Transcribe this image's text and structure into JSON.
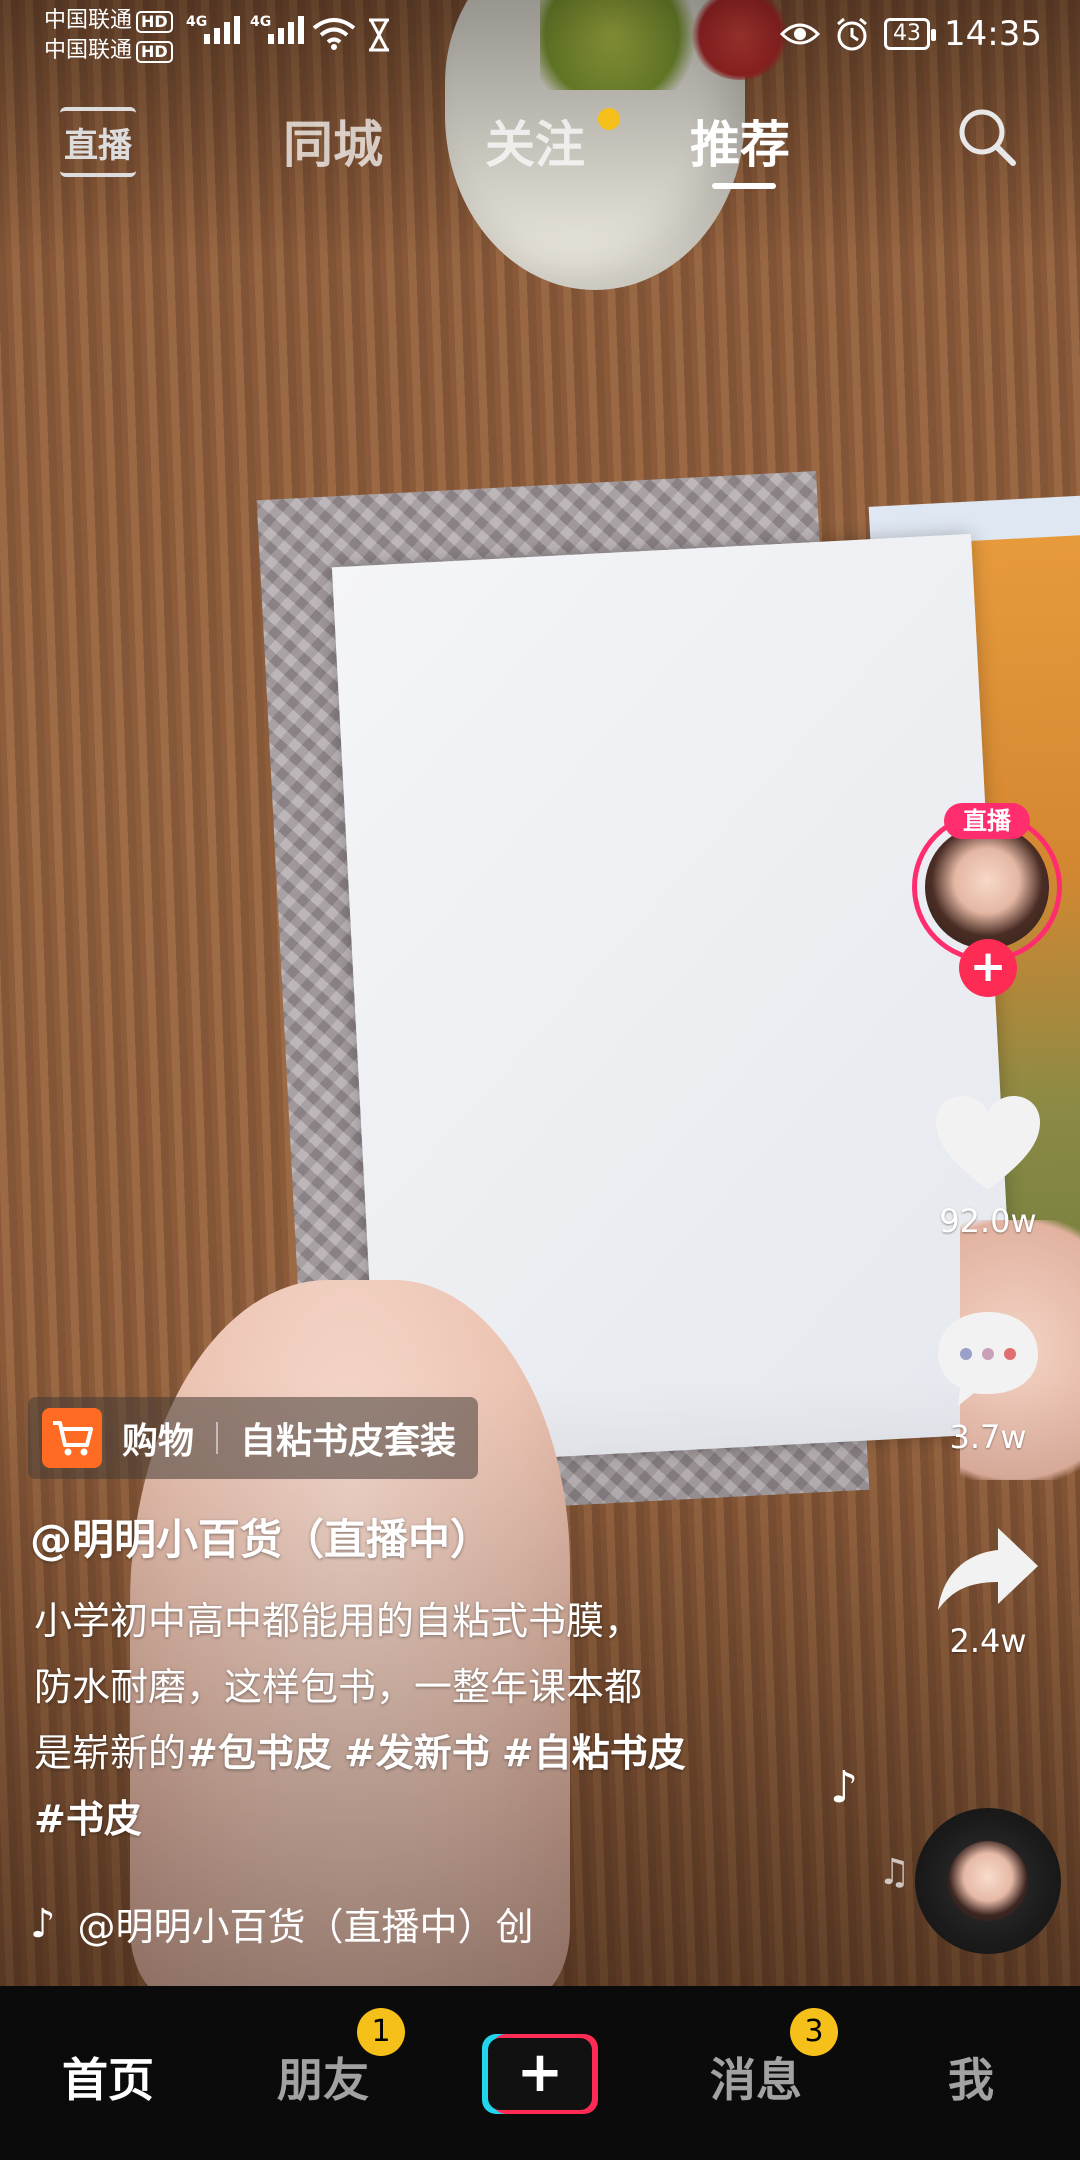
{
  "status_bar": {
    "carrier_1": "中国联通",
    "carrier_2": "中国联通",
    "hd_badge": "HD",
    "network_type": "4G",
    "battery": "43",
    "time": "14:35"
  },
  "top_nav": {
    "live_label": "直播",
    "tabs": [
      "同城",
      "关注",
      "推荐"
    ],
    "active_tab": "推荐",
    "notification_dot_color": "#f6c01a"
  },
  "right_rail": {
    "live_tag": "直播",
    "follow_symbol": "+",
    "likes": "92.0w",
    "comments": "3.7w",
    "shares": "2.4w"
  },
  "shop": {
    "label": "购物",
    "title": "自粘书皮套装",
    "icon": "cart-icon",
    "icon_color": "#ff6b22"
  },
  "post": {
    "author": "@明明小百货（直播中）",
    "description_text_1": "小学初中高中都能用的自粘式书膜，",
    "description_text_2": "防水耐磨，这样包书，一整年课本都",
    "description_text_3": "是崭新的",
    "hashtags": [
      "#包书皮",
      "#发新书",
      "#自粘书皮",
      "#书皮"
    ],
    "music": "@明明小百货（直播中）创"
  },
  "bottom_nav": {
    "home": "首页",
    "friends": "朋友",
    "friends_badge": "1",
    "create": "+",
    "messages": "消息",
    "messages_badge": "3",
    "me": "我"
  }
}
